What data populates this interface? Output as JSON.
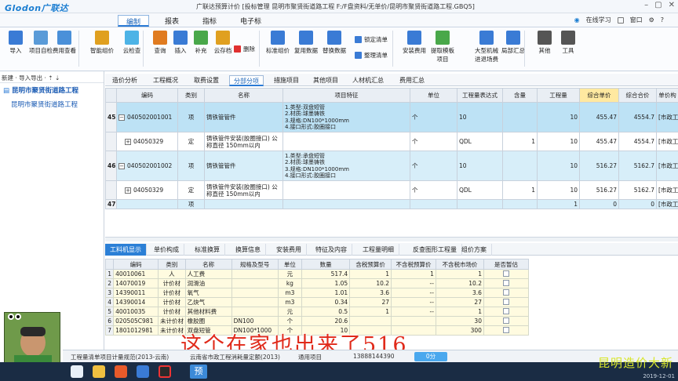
{
  "window": {
    "logo": "Glodon广联达",
    "title": "广联达预算计价  [投标管理  昆明市聚贤街道路工程  F:/F盘资料/无单价/昆明市聚贤街道路工程.GBQ5]"
  },
  "menu": {
    "tabs": [
      "编制",
      "报表",
      "指标",
      "电子标"
    ],
    "active": "编制",
    "right": [
      "在线学习",
      "窗口"
    ]
  },
  "ribbon": {
    "buttons": [
      {
        "label": "导入",
        "icon": "import-icon",
        "color": "#3a7bd5"
      },
      {
        "label": "项目自检",
        "icon": "check-icon",
        "color": "#5a9bd8"
      },
      {
        "label": "费用查看",
        "icon": "view-cost-icon",
        "color": "#4a90d9"
      },
      {
        "label": "智能组价",
        "icon": "smart-price-icon",
        "color": "#e0a020"
      },
      {
        "label": "云检查",
        "icon": "cloud-check-icon",
        "color": "#4db3e6"
      },
      {
        "label": "查询",
        "icon": "query-icon",
        "color": "#e07b20"
      },
      {
        "label": "插入",
        "icon": "insert-icon",
        "color": "#3a7bd5"
      },
      {
        "label": "补充",
        "icon": "supplement-icon",
        "color": "#49a84a"
      },
      {
        "label": "云存档",
        "icon": "cloud-save-icon",
        "color": "#e0a020"
      },
      {
        "label": "标准组价",
        "icon": "standard-price-icon",
        "color": "#3a7bd5"
      },
      {
        "label": "复用数据",
        "icon": "reuse-data-icon",
        "color": "#3a7bd5"
      },
      {
        "label": "替换数据",
        "icon": "replace-data-icon",
        "color": "#3a7bd5"
      },
      {
        "label": "安装费用",
        "icon": "install-fee-icon",
        "color": "#3a7bd5"
      },
      {
        "label": "提取模板项目",
        "icon": "template-icon",
        "color": "#49a84a"
      },
      {
        "label": "大型机械进退场费",
        "icon": "machinery-icon",
        "color": "#3a7bd5"
      },
      {
        "label": "局部汇总",
        "icon": "local-summary-icon",
        "color": "#3a7bd5"
      },
      {
        "label": "其他",
        "icon": "other-icon",
        "color": "#555555"
      },
      {
        "label": "工具",
        "icon": "tools-icon",
        "color": "#555555"
      }
    ],
    "small": {
      "delete": "删除",
      "lock_list": "锁定清单",
      "organize_list": "整理清单"
    }
  },
  "left_panel": {
    "toolbar": "新建 · 导入导出 ·  ⇡  ⇣",
    "items": [
      "昆明市聚贤街道路工程",
      "昆明市聚贤街道路工程"
    ]
  },
  "main_tabs": [
    "造价分析",
    "工程概况",
    "取费设置",
    "分部分项",
    "措施项目",
    "其他项目",
    "人材机汇总",
    "费用汇总"
  ],
  "main_active": "分部分项",
  "upper_grid": {
    "columns": [
      "",
      "编码",
      "类别",
      "名称",
      "项目特征",
      "单位",
      "工程量表达式",
      "含量",
      "工程量",
      "综合单价",
      "综合合价",
      "单价构"
    ],
    "rows": [
      {
        "no": "45",
        "code": "040502001001",
        "type": "项",
        "name": "铸铁管管件",
        "feature": "1.类型:双盘短管\n2.材质:球墨铸铁\n3.规格:DN100*1000mm\n4.接口形式:胶圈接口",
        "unit": "个",
        "expr": "10",
        "content": "",
        "qty": "10",
        "unit_price": "455.47",
        "total": "4554.7",
        "ref": "[市政工"
      },
      {
        "no": "",
        "code": "04050329",
        "type": "定",
        "name": "铸铁管件安装(胶圈接口) 公\n称直径 150mm以内",
        "feature": "",
        "unit": "个",
        "expr": "QDL",
        "content": "1",
        "qty": "10",
        "unit_price": "455.47",
        "total": "4554.7",
        "ref": "[市政工"
      },
      {
        "no": "46",
        "code": "040502001002",
        "type": "项",
        "name": "铸铁管管件",
        "feature": "1.类型:承盘短管\n2.材质:球墨铸铁\n3.规格:DN100*1000mm\n4.接口形式:胶圈接口",
        "unit": "个",
        "expr": "10",
        "content": "",
        "qty": "10",
        "unit_price": "516.27",
        "total": "5162.7",
        "ref": "[市政工"
      },
      {
        "no": "",
        "code": "04050329",
        "type": "定",
        "name": "铸铁管件安装(胶圈接口) 公\n称直径 150mm以内",
        "feature": "",
        "unit": "个",
        "expr": "QDL",
        "content": "1",
        "qty": "10",
        "unit_price": "516.27",
        "total": "5162.7",
        "ref": "[市政工"
      },
      {
        "no": "47",
        "code": "",
        "type": "项",
        "name": "",
        "feature": "",
        "unit": "",
        "expr": "",
        "content": "",
        "qty": "1",
        "unit_price": "0",
        "total": "0",
        "ref": "[市政工"
      }
    ]
  },
  "lower_tabs": [
    "工料机显示",
    "单价构成",
    "标准换算",
    "换算信息",
    "安装费用",
    "特征及内容",
    "工程量明细",
    "反查图形工程量",
    "组价方案"
  ],
  "lower_active": "工料机显示",
  "lower_grid": {
    "columns": [
      "",
      "编码",
      "类别",
      "名称",
      "规格及型号",
      "单位",
      "数量",
      "含税预算价",
      "不含税预算价",
      "不含税市场价",
      "是否暂估"
    ],
    "rows": [
      {
        "no": "1",
        "code": "40010061",
        "type": "人",
        "name": "人工费",
        "spec": "",
        "unit": "元",
        "qty": "517.4",
        "p1": "1",
        "p2": "1",
        "p3": "1"
      },
      {
        "no": "2",
        "code": "14070019",
        "type": "计价材",
        "name": "润滑油",
        "spec": "",
        "unit": "kg",
        "qty": "1.05",
        "p1": "10.2",
        "p2": "--",
        "p3": "10.2"
      },
      {
        "no": "3",
        "code": "14390011",
        "type": "计价材",
        "name": "氧气",
        "spec": "",
        "unit": "m3",
        "qty": "1.01",
        "p1": "3.6",
        "p2": "--",
        "p3": "3.6"
      },
      {
        "no": "4",
        "code": "14390014",
        "type": "计价材",
        "name": "乙炔气",
        "spec": "",
        "unit": "m3",
        "qty": "0.34",
        "p1": "27",
        "p2": "--",
        "p3": "27"
      },
      {
        "no": "5",
        "code": "40010035",
        "type": "计价材",
        "name": "其他材料费",
        "spec": "",
        "unit": "元",
        "qty": "0.5",
        "p1": "1",
        "p2": "--",
        "p3": "1"
      },
      {
        "no": "6",
        "code": "020505C981",
        "type": "未计价材",
        "name": "橡胶圈",
        "spec": "DN100",
        "unit": "个",
        "qty": "20.6",
        "p1": "",
        "p2": "",
        "p3": "30"
      },
      {
        "no": "7",
        "code": "1801012981",
        "type": "未计价材",
        "name": "双盘短管",
        "spec": "DN100*1000",
        "unit": "个",
        "qty": "10",
        "p1": "",
        "p2": "",
        "p3": "300"
      }
    ]
  },
  "subtitle": "这个在家也出来了516",
  "status": {
    "norm": "工程量清单项目计量规范(2013-云南)",
    "quota": "云南省市政工程消耗量定额(2013)",
    "common": "通用项目",
    "phone": "13888144390",
    "button": "0分"
  },
  "watermark": "昆明造价大新",
  "clock": "2019-12-01",
  "taskbar": {
    "ppt_label": "预"
  },
  "colors": {
    "accent": "#2a7ad5",
    "selected_row": "#bde2f5",
    "lower_row": "#fffbe0",
    "subtitle": "#e02a1a"
  }
}
